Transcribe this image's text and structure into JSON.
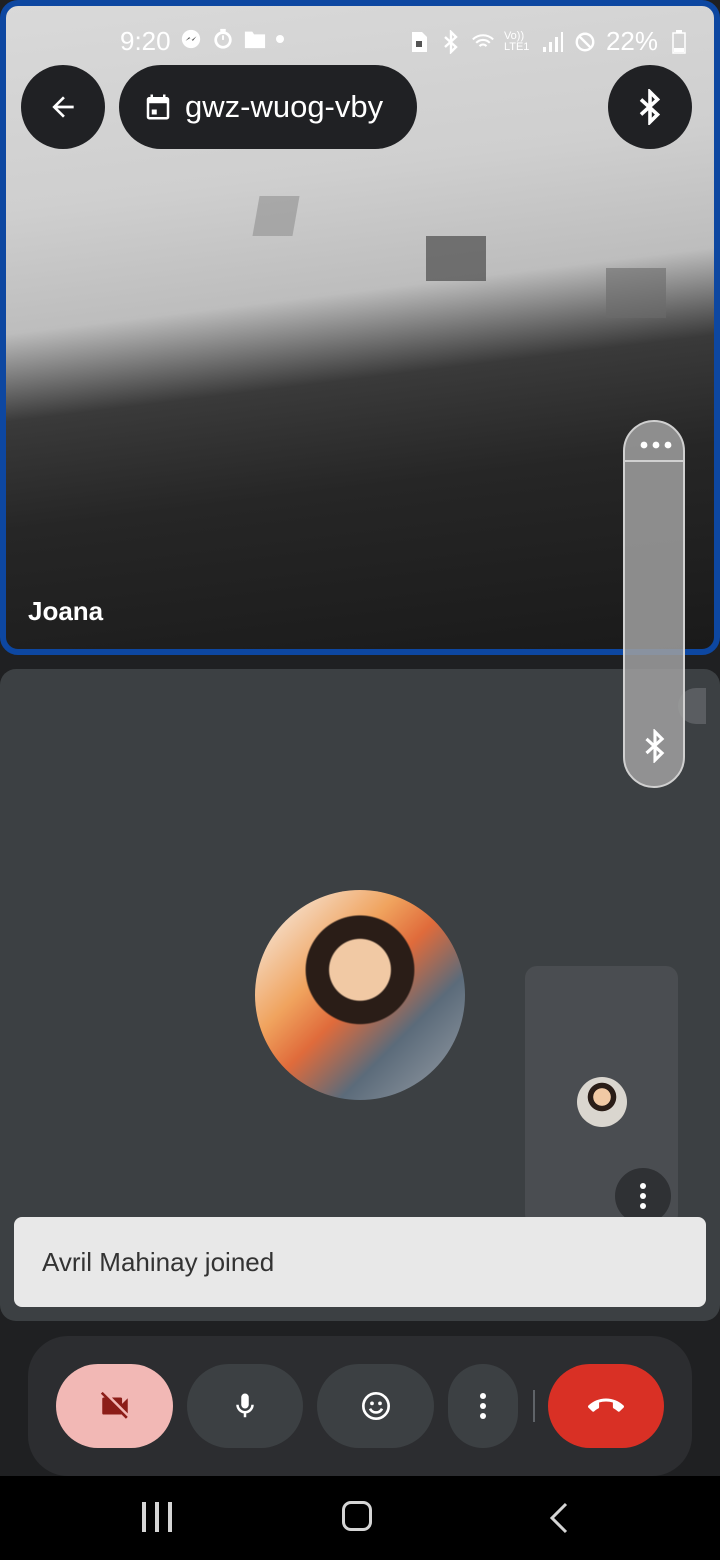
{
  "status_bar": {
    "time": "9:20",
    "battery": "22%",
    "network": "Vo)) LTE1"
  },
  "call": {
    "meeting_code": "gwz-wuog-vby",
    "remote_participant_name": "Joana",
    "toast_message": "Avril Mahinay joined"
  },
  "icons": {
    "back": "arrow-left-icon",
    "calendar": "calendar-icon",
    "bluetooth": "bluetooth-icon",
    "more": "more-vertical-icon",
    "camera_off": "videocam-off-icon",
    "mic": "mic-icon",
    "emoji": "emoji-icon",
    "end_call": "call-end-icon"
  },
  "colors": {
    "active_speaker_border": "#0d47a1",
    "end_call": "#d93025",
    "camera_off_bg": "#f2b8b5",
    "camera_off_icon": "#8c1d18"
  }
}
